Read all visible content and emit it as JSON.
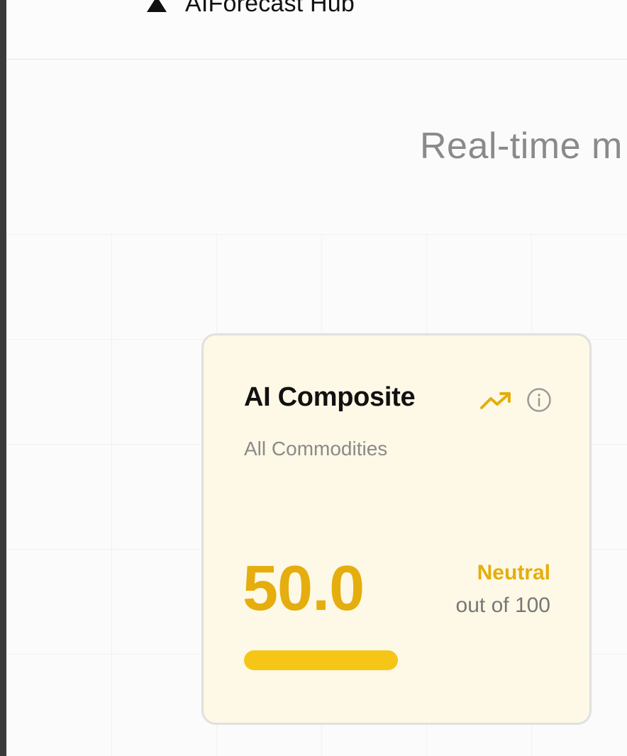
{
  "header": {
    "app_name": "AIForecast Hub",
    "logo_icon": "triangle-logo-icon"
  },
  "hero": {
    "subtitle": "Real-time m"
  },
  "card": {
    "title": "AI Composite",
    "subtitle": "All Commodities",
    "score": "50.0",
    "score_fraction": 0.5,
    "sentiment": "Neutral",
    "scale_label": "out of 100",
    "trend_icon": "trending-up-icon",
    "info_icon": "info-icon",
    "accent_color": "#e5ad0e",
    "bar_color": "#f6c617",
    "card_background": "#fdf9e6"
  }
}
